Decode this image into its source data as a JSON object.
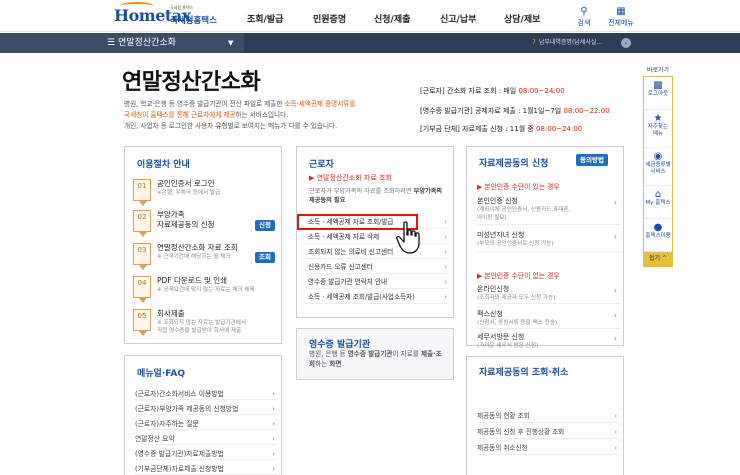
{
  "header": {
    "logo_text": "Hometax",
    "logo_tiny": "국세청 홈택스",
    "logo_sub": "국세청홈택스",
    "nav": [
      "조회/발급",
      "민원증명",
      "신청/제출",
      "신고/납부",
      "상담/제보"
    ],
    "search_label": "검색",
    "allmenu_label": "전체메뉴"
  },
  "bar": {
    "title": "연말정산간소화",
    "notice_num": "7",
    "notice_text": "납부내역증명(납세사실..."
  },
  "page": {
    "title": "연말정산간소화",
    "intro_a": "병원, 학교·은행 등 영수증 발급기관이 전산 파일로 제출한 ",
    "intro_b": "소득·세액공제 증명서류를",
    "intro_c": "국세청이 홈택스를 통해 근로자에게 제공",
    "intro_d": "하는 서비스입니다.",
    "intro_e": "개인, 사업자 등 로그인한 사용자 유형별로 보여지는 메뉴가 다를 수 있습니다.",
    "schedule": [
      {
        "label": "[근로자] 간소화 자료 조회 : 매일 ",
        "time": "08:00~24:00"
      },
      {
        "label": "[영수증 발급기관] 공제자료 제출 : 1월1일~7일 ",
        "time": "08:00~22:00"
      },
      {
        "label": "[기부금 단체] 자료제출 신청 : 11월 중 ",
        "time": "08:00~24:00"
      }
    ]
  },
  "procedure": {
    "title": "이용절차 안내",
    "steps": [
      {
        "num": "01",
        "title": "공인인증서 로그인",
        "sub": "※은행, 우체국 등에서 발급",
        "badge": ""
      },
      {
        "num": "02",
        "title": "부양가족\n자료제공동의 신청",
        "sub": "",
        "badge": "신청"
      },
      {
        "num": "03",
        "title": "연말정산간소화 자료 조회",
        "sub": "※ 근무기간에 해당하는 월 체크",
        "badge": "조회"
      },
      {
        "num": "04",
        "title": "PDF 다운로드 및 인쇄",
        "sub": "※ 공제요건에 맞지 않는 자료는 체크 해제",
        "badge": ""
      },
      {
        "num": "05",
        "title": "회사제출",
        "sub": "※ 조회되지 않는 자료는 발급기관에서\n직접 영수증을 발급받아 회사에 제출",
        "badge": ""
      }
    ]
  },
  "faq": {
    "title": "메뉴얼·FAQ",
    "items": [
      "(근로자)간소화서비스 이용방법",
      "(근로자)부양가족 제공동의 신청방법",
      "(근로자)자주하는 질문",
      "연말정산 요약",
      "(영수증 발급기관)자료제출방법",
      "(기부금단체)자료제출 신청방법"
    ]
  },
  "worker": {
    "title": "근로자",
    "red_title": "▶ 연말정산간소화 자료 조회",
    "desc_a": "근로자가 부양가족의 자료를 조회하려면 ",
    "desc_b": "부양가족의 제공동의 필요",
    "links": [
      "소득 · 세액공제 자료 조회/발급",
      "소득 · 세액공제 자료 삭제",
      "조회되지 않는 의료비 신고센터",
      "신용카드 오류 신고센터",
      "영수증 발급기관 연락처 안내",
      "소득 · 세액공제 조회/발급(사업소득자)"
    ]
  },
  "receipt": {
    "title": "영수증 발급기관",
    "desc_a": "병원, 은행 등 ",
    "desc_b": "영수증 발급기관",
    "desc_c": "이 자료를 ",
    "desc_d": "제출·조회",
    "desc_e": "하는 ",
    "desc_f": "화면"
  },
  "apply": {
    "title": "자료제공동의 신청",
    "badge": "동의방법",
    "section1": "▶ 본인인증 수단이 있는 경우",
    "items1": [
      {
        "title": "본인인증 신청",
        "sub": "(계좌이체 공인인증서, 신용카드,휴대폰,\n아이핀 필요)"
      },
      {
        "title": "미성년자녀 신청",
        "sub": "(부모의 공인인증서로 신청 가능)"
      }
    ],
    "section2": "▶ 본인인증 수단이 없는 경우",
    "items2": [
      {
        "title": "온라인신청",
        "sub": "(조회자와 제공자 모두 신청 가능)"
      },
      {
        "title": "팩스신청",
        "sub": "(신청서, 증빙서류 등을 팩스 전송)"
      },
      {
        "title": "세무서방문 신청",
        "sub": "(가까운 세무서 방문 신청)"
      }
    ]
  },
  "inquiry": {
    "title": "자료제공동의 조회·취소",
    "items": [
      "제공동의 현황 조회",
      "제공동의 신청 후 진행상황 조회",
      "제공동의 취소신청"
    ]
  },
  "quick": {
    "caption": "바로가기",
    "items": [
      {
        "label": "로그아웃",
        "icon": "lock-icon"
      },
      {
        "label": "자주찾는\n메뉴",
        "icon": "star-icon"
      },
      {
        "label": "세금종류별\n서비스",
        "icon": "coin-icon"
      },
      {
        "label": "My 홈택스",
        "icon": "home-icon"
      },
      {
        "label": "홈택스이용",
        "icon": "person-icon"
      }
    ],
    "top": "접기 ^"
  }
}
